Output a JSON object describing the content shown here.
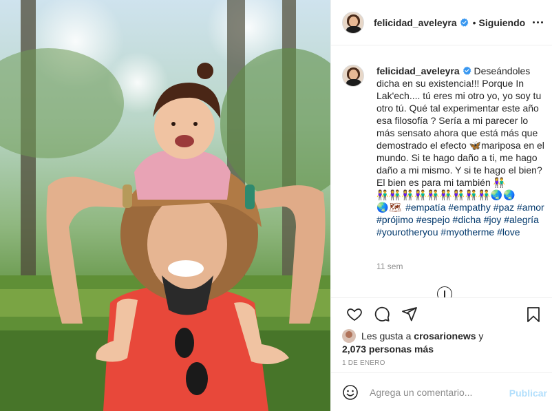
{
  "post": {
    "username": "felicidad_aveleyra",
    "follow_status": "Siguiendo",
    "separator": "•",
    "caption": {
      "username": "felicidad_aveleyra",
      "text": " Deseándoles dicha en su existencia!!! Porque In Lak'ech.... tú eres mi otro yo, yo soy tu otro tú. Qué tal experimentar este año esa filosofía ? Sería a mi parecer lo más sensato ahora que está más que demostrado el efecto 🦋mariposa en el mundo. Si te hago daño a ti, me hago daño a mi mismo. Y si te hago el bien? El bien es para mi también 👫",
      "emojis": "👫👫👫👫👫👫👫👫👫🌏🌏",
      "emojis2": "🌏🗺 ",
      "hashtags": [
        "#empatía",
        "#empathy",
        "#paz",
        "#amor",
        "#prójimo",
        "#espejo",
        "#dicha",
        "#joy",
        "#alegría",
        "#yourotheryou",
        "#myotherme",
        "#love"
      ],
      "time_ago": "11 sem"
    },
    "likes": {
      "prefix": "Les gusta a ",
      "user": "crosarionews",
      "middle": " y",
      "count": "2,073 personas más"
    },
    "date": "1 DE ENERO",
    "comment_placeholder": "Agrega un comentario...",
    "publish_label": "Publicar",
    "icons": [
      "heart-icon",
      "comment-icon",
      "share-icon",
      "bookmark-icon",
      "more-options-icon",
      "verified-badge-icon",
      "emoji-icon",
      "load-more-icon"
    ],
    "colors": {
      "link": "#00376b",
      "muted": "#8e8e8e",
      "verified": "#3897f0",
      "publish_disabled": "#b2dffc"
    }
  }
}
